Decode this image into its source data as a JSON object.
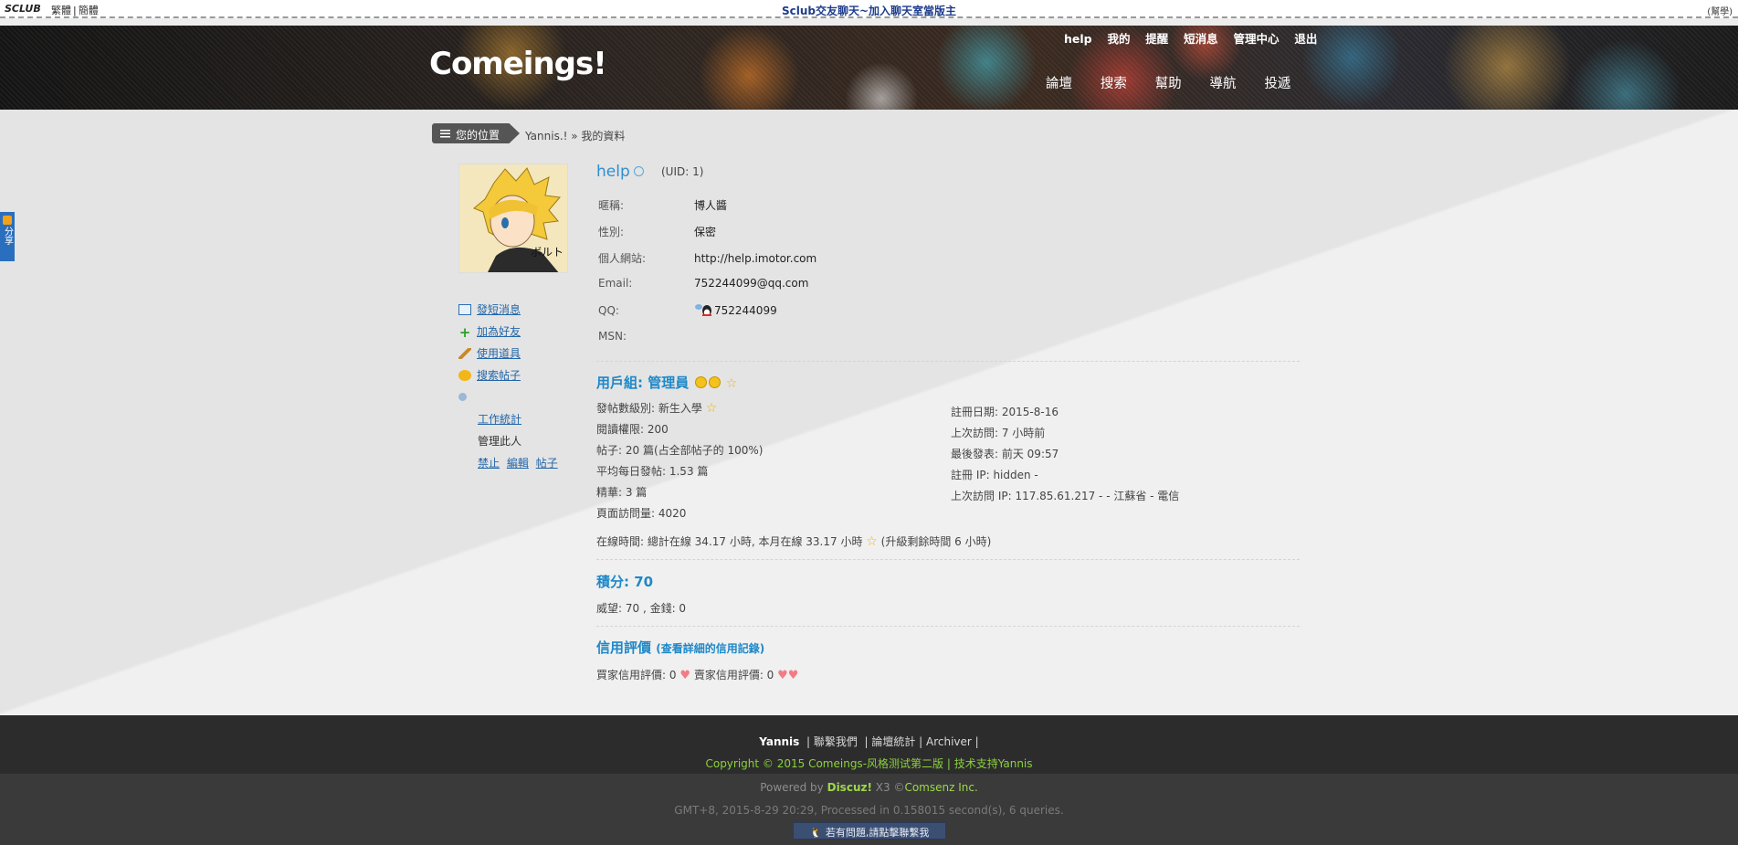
{
  "topbar": {
    "brand": "SCLUB",
    "lang_trad": "繁體",
    "lang_simp": "簡體",
    "center_title": "Sclub交友聊天~加入聊天室當版主",
    "right_text": "(幫學)"
  },
  "header": {
    "logo": "Comeings!",
    "top_links": [
      "help",
      "我的",
      "提醒",
      "短消息",
      "管理中心",
      "退出"
    ],
    "nav": [
      "論壇",
      "搜索",
      "幫助",
      "導航",
      "投遞"
    ]
  },
  "side_share": "分享",
  "breadcrumb": {
    "home": "您的位置",
    "path": "Yannis.! » 我的資料"
  },
  "actions": {
    "send_msg": "發短消息",
    "add_friend": "加為好友",
    "use_tool": "使用道具",
    "search_posts": "搜索帖子",
    "work_stats": "工作統計",
    "manage_user": "管理此人",
    "ban": "禁止",
    "edit": "編輯",
    "posts": "帖子"
  },
  "profile": {
    "username": "help",
    "uid": "(UID: 1)",
    "fields": [
      {
        "k": "暱稱:",
        "v": "博人醬"
      },
      {
        "k": "性別:",
        "v": "保密"
      },
      {
        "k": "個人網站:",
        "v": "http://help.imotor.com"
      },
      {
        "k": "Email:",
        "v": "752244099@qq.com"
      },
      {
        "k": "QQ:",
        "v": "752244099"
      },
      {
        "k": "MSN:",
        "v": ""
      }
    ]
  },
  "group": {
    "title": "用戶組: 管理員",
    "left": [
      "發帖數級別: 新生入學",
      "閱讀權限: 200",
      "帖子: 20 篇(占全部帖子的 100%)",
      "平均每日發帖: 1.53 篇",
      "精華: 3 篇",
      "頁面訪問量: 4020"
    ],
    "right": [
      "註冊日期: 2015-8-16",
      "上次訪問: 7 小時前",
      "最後發表: 前天 09:57",
      "註冊 IP: hidden -",
      "上次訪問 IP: 117.85.61.217 - - 江蘇省 - 電信"
    ],
    "online_a": "在線時間: 總計在線 34.17 小時, 本月在線 33.17 小時",
    "online_b": "(升級剩餘時間 6 小時)"
  },
  "points": {
    "title": "積分: 70",
    "line": "威望: 70 , 金錢: 0"
  },
  "credit": {
    "title": "信用評價",
    "link": "(查看詳細的信用記錄)",
    "buyer": "買家信用評價: 0",
    "seller": "賣家信用評價: 0"
  },
  "footer": {
    "author": "Yannis",
    "links": [
      "聯繫我們",
      "論壇統計",
      "Archiver"
    ],
    "copyright": "Copyright © 2015 Comeings-风格测试第二版 | 技术支持Yannis",
    "powered_a": "Powered by",
    "discuz": "Discuz!",
    "powered_b": "X3 ©",
    "comsenz": "Comsenz Inc.",
    "gmt": "GMT+8, 2015-8-29 20:29, Processed in 0.158015 second(s), 6 queries.",
    "contact": "若有問題,請點擊聯繫我"
  }
}
